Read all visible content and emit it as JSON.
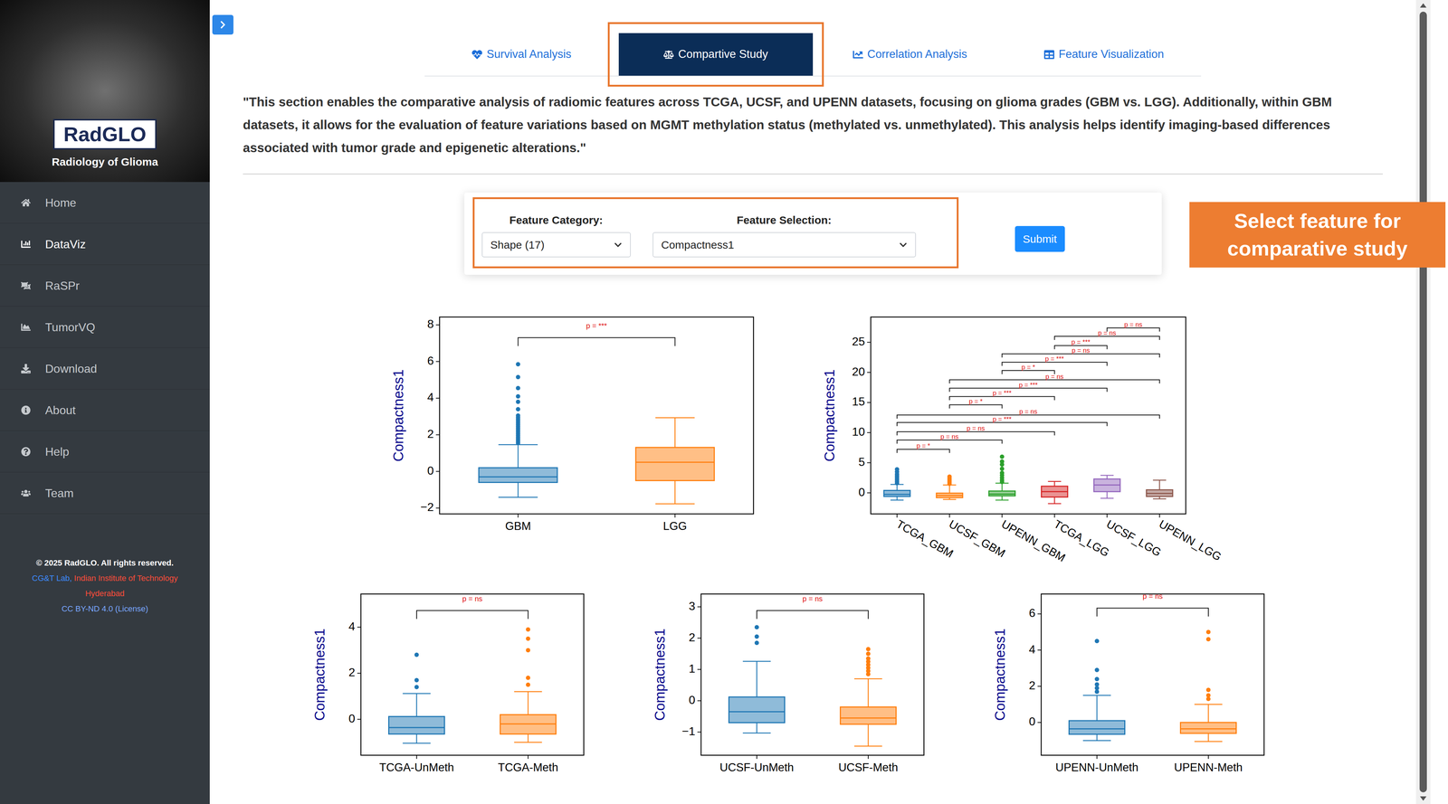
{
  "sidebar": {
    "logo": {
      "title": "RadGLO",
      "subtitle": "Radiology of Glioma"
    },
    "items": [
      {
        "label": "Home",
        "selected": false
      },
      {
        "label": "DataViz",
        "selected": true
      },
      {
        "label": "RaSPr",
        "selected": false
      },
      {
        "label": "TumorVQ",
        "selected": false
      },
      {
        "label": "Download",
        "selected": false
      },
      {
        "label": "About",
        "selected": false
      },
      {
        "label": "Help",
        "selected": false
      },
      {
        "label": "Team",
        "selected": false
      }
    ],
    "footer": {
      "copyright": "© 2025 RadGLO. All rights reserved.",
      "lab": "CG&T Lab,",
      "institute": "Indian Institute of Technology Hyderabad",
      "license": "CC BY-ND 4.0 (License)"
    }
  },
  "tabs": [
    {
      "label": "Survival Analysis",
      "selected": false,
      "highlighted": false
    },
    {
      "label": "Compartive Study",
      "selected": true,
      "highlighted": true
    },
    {
      "label": "Correlation Analysis",
      "selected": false,
      "highlighted": false
    },
    {
      "label": "Feature Visualization",
      "selected": false,
      "highlighted": false
    }
  ],
  "description": "\"This section enables the comparative analysis of radiomic features across TCGA, UCSF, and UPENN datasets, focusing on glioma grades (GBM vs. LGG). Additionally, within GBM datasets, it allows for the evaluation of feature variations based on MGMT methylation status (methylated vs. unmethylated). This analysis helps identify imaging-based differences associated with tumor grade and epigenetic alterations.\"",
  "controls": {
    "highlighted": true,
    "category": {
      "label": "Feature Category:",
      "value": "Shape (17)"
    },
    "feature": {
      "label": "Feature Selection:",
      "value": "Compactness1"
    },
    "submit": "Submit"
  },
  "callout": "Select feature for comparative study",
  "grade_charts": [
    {
      "y_label": "Compactness1",
      "y_min": -2.32,
      "y_max": 8.43,
      "ticks": [
        "−2",
        "0",
        "2",
        "4",
        "6",
        "8"
      ],
      "groups": [
        {
          "label": "GBM",
          "color": "#1f77b4",
          "whisker_low": -1.41,
          "q1": -0.6,
          "median": -0.3,
          "q3": 0.2,
          "whisker_high": 1.46,
          "outliers": [
            1.55,
            1.65,
            1.75,
            1.85,
            1.95,
            2.05,
            2.15,
            2.25,
            2.35,
            2.45,
            2.55,
            2.65,
            2.75,
            2.85,
            2.95,
            3.05,
            3.4,
            3.8,
            4.1,
            4.55,
            5.15,
            5.85
          ]
        },
        {
          "label": "LGG",
          "color": "#ff7f0e",
          "whisker_low": -1.77,
          "q1": -0.5,
          "median": 0.5,
          "q3": 1.31,
          "whisker_high": 2.93,
          "outliers": []
        }
      ],
      "brackets": [
        {
          "from": 0,
          "to": 1,
          "y": 7.3,
          "label": "p = ***"
        }
      ]
    },
    {
      "y_label": "Compactness1",
      "y_min": -3.5,
      "y_max": 29.2,
      "ticks": [
        "0",
        "5",
        "10",
        "15",
        "20",
        "25"
      ],
      "groups": [
        {
          "label": "TCGA_GBM",
          "color": "#1f77b4",
          "whisker_low": -1.2,
          "q1": -0.6,
          "median": -0.25,
          "q3": 0.4,
          "whisker_high": 1.4,
          "outliers": [
            1.6,
            1.9,
            2.2,
            2.5,
            2.8,
            3.1,
            3.5,
            3.9
          ]
        },
        {
          "label": "UCSF_GBM",
          "color": "#ff7f0e",
          "whisker_low": -1.1,
          "q1": -0.8,
          "median": -0.45,
          "q3": -0.05,
          "whisker_high": 1.3,
          "outliers": [
            1.5,
            1.8,
            2.1,
            2.4,
            2.7
          ]
        },
        {
          "label": "UPENN_GBM",
          "color": "#2ca02c",
          "whisker_low": -1.2,
          "q1": -0.5,
          "median": -0.2,
          "q3": 0.3,
          "whisker_high": 1.6,
          "outliers": [
            1.8,
            2.1,
            2.5,
            2.9,
            3.3,
            4.0,
            4.7,
            5.2,
            6.0
          ]
        },
        {
          "label": "TCGA_LGG",
          "color": "#d62728",
          "whisker_low": -1.8,
          "q1": -0.7,
          "median": 0.2,
          "q3": 1.1,
          "whisker_high": 1.9,
          "outliers": []
        },
        {
          "label": "UCSF_LGG",
          "color": "#9467bd",
          "whisker_low": -0.9,
          "q1": 0.2,
          "median": 1.3,
          "q3": 2.3,
          "whisker_high": 2.9,
          "outliers": []
        },
        {
          "label": "UPENN_LGG",
          "color": "#8c564b",
          "whisker_low": -1.0,
          "q1": -0.6,
          "median": -0.1,
          "q3": 0.5,
          "whisker_high": 2.1,
          "outliers": []
        }
      ],
      "brackets": [
        {
          "from": 0,
          "to": 1,
          "y": 7.23,
          "label": "p = *"
        },
        {
          "from": 0,
          "to": 2,
          "y": 8.77,
          "label": "p = ns"
        },
        {
          "from": 0,
          "to": 3,
          "y": 10.15,
          "label": "p = ns"
        },
        {
          "from": 0,
          "to": 4,
          "y": 11.69,
          "label": "p = ***"
        },
        {
          "from": 0,
          "to": 5,
          "y": 12.92,
          "label": "p = ns"
        },
        {
          "from": 1,
          "to": 2,
          "y": 14.62,
          "label": "p = *"
        },
        {
          "from": 1,
          "to": 3,
          "y": 16.0,
          "label": "p = ***"
        },
        {
          "from": 1,
          "to": 4,
          "y": 17.38,
          "label": "p = ***"
        },
        {
          "from": 1,
          "to": 5,
          "y": 18.77,
          "label": "p = ns"
        },
        {
          "from": 2,
          "to": 3,
          "y": 20.31,
          "label": "p = *"
        },
        {
          "from": 2,
          "to": 4,
          "y": 21.69,
          "label": "p = ***"
        },
        {
          "from": 2,
          "to": 5,
          "y": 23.08,
          "label": "p = ns"
        },
        {
          "from": 3,
          "to": 4,
          "y": 24.46,
          "label": "p = ***"
        },
        {
          "from": 3,
          "to": 5,
          "y": 26.0,
          "label": "p = ns"
        },
        {
          "from": 4,
          "to": 5,
          "y": 27.38,
          "label": "p = ns"
        }
      ]
    }
  ],
  "methylation_charts": [
    {
      "y_label": "Compactness1",
      "y_min": -1.56,
      "y_max": 5.44,
      "ticks": [
        "0",
        "2",
        "4"
      ],
      "groups": [
        {
          "label": "TCGA-UnMeth",
          "color": "#1f77b4",
          "whisker_low": -1.04,
          "q1": -0.64,
          "median": -0.36,
          "q3": 0.12,
          "whisker_high": 1.12,
          "outliers": [
            1.4,
            1.7,
            2.8
          ]
        },
        {
          "label": "TCGA-Meth",
          "color": "#ff7f0e",
          "whisker_low": -1.0,
          "q1": -0.64,
          "median": -0.2,
          "q3": 0.2,
          "whisker_high": 1.2,
          "outliers": [
            1.5,
            1.8,
            3.0,
            3.5,
            3.9
          ]
        }
      ],
      "brackets": [
        {
          "from": 0,
          "to": 1,
          "y": 4.72,
          "label": "p = ns"
        }
      ]
    },
    {
      "y_label": "Compactness1",
      "y_min": -1.74,
      "y_max": 3.41,
      "ticks": [
        "−1",
        "0",
        "1",
        "2",
        "3"
      ],
      "groups": [
        {
          "label": "UCSF-UnMeth",
          "color": "#1f77b4",
          "whisker_low": -1.03,
          "q1": -0.7,
          "median": -0.35,
          "q3": 0.12,
          "whisker_high": 1.26,
          "outliers": [
            1.85,
            2.05,
            2.35
          ]
        },
        {
          "label": "UCSF-Meth",
          "color": "#ff7f0e",
          "whisker_low": -1.45,
          "q1": -0.75,
          "median": -0.55,
          "q3": -0.2,
          "whisker_high": 0.7,
          "outliers": [
            0.85,
            0.95,
            1.05,
            1.15,
            1.25,
            1.35,
            1.5,
            1.65
          ]
        }
      ],
      "brackets": [
        {
          "from": 0,
          "to": 1,
          "y": 2.88,
          "label": "p = ns"
        }
      ]
    },
    {
      "y_label": "Compactness1",
      "y_min": -1.81,
      "y_max": 7.1,
      "ticks": [
        "0",
        "2",
        "4",
        "6"
      ],
      "groups": [
        {
          "label": "UPENN-UnMeth",
          "color": "#1f77b4",
          "whisker_low": -1.0,
          "q1": -0.65,
          "median": -0.35,
          "q3": 0.1,
          "whisker_high": 1.5,
          "outliers": [
            1.7,
            1.9,
            2.1,
            2.4,
            2.9,
            4.5
          ]
        },
        {
          "label": "UPENN-Meth",
          "color": "#ff7f0e",
          "whisker_low": -1.05,
          "q1": -0.6,
          "median": -0.35,
          "q3": 0.0,
          "whisker_high": 1.0,
          "outliers": [
            1.3,
            1.5,
            1.8,
            4.6,
            5.0
          ]
        }
      ],
      "brackets": [
        {
          "from": 0,
          "to": 1,
          "y": 6.32,
          "label": "p = ns"
        }
      ]
    }
  ]
}
